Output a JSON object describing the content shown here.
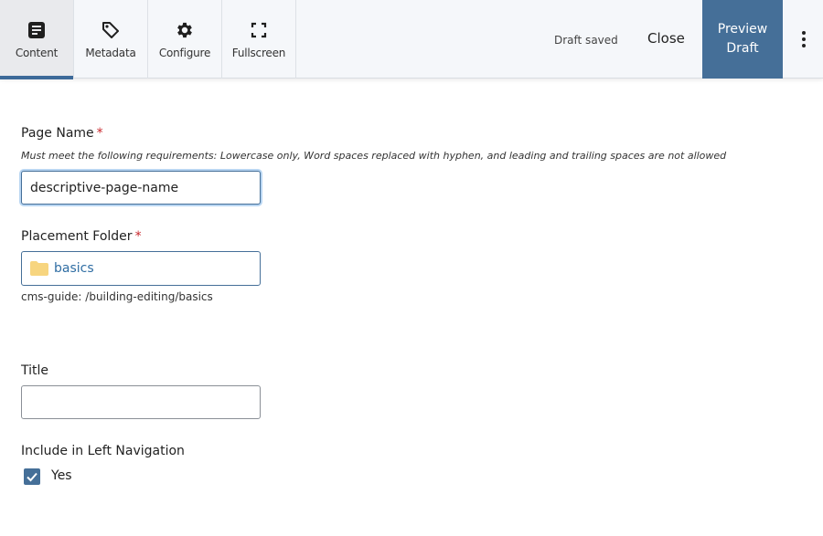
{
  "toolbar": {
    "tabs": [
      {
        "label": "Content",
        "icon": "document-icon",
        "active": true
      },
      {
        "label": "Metadata",
        "icon": "tag-icon",
        "active": false
      },
      {
        "label": "Configure",
        "icon": "gear-icon",
        "active": false
      },
      {
        "label": "Fullscreen",
        "icon": "fullscreen-icon",
        "active": false
      }
    ],
    "status": "Draft saved",
    "close_label": "Close",
    "preview_label_line1": "Preview",
    "preview_label_line2": "Draft",
    "more_icon": "kebab-menu-icon"
  },
  "form": {
    "page_name": {
      "label": "Page Name",
      "required_mark": "*",
      "hint": "Must meet the following requirements: Lowercase only, Word spaces replaced with hyphen, and leading and trailing spaces are not allowed",
      "value": "descriptive-page-name"
    },
    "placement_folder": {
      "label": "Placement Folder",
      "required_mark": "*",
      "folder_icon": "folder-icon",
      "value": "basics",
      "path": "cms-guide: /building-editing/basics"
    },
    "title": {
      "label": "Title",
      "value": ""
    },
    "left_nav": {
      "label": "Include in Left Navigation",
      "option_label": "Yes",
      "checked": true
    }
  },
  "colors": {
    "accent": "#456f98",
    "required": "#c8262b",
    "folder": "#f7d57f",
    "link": "#2f6da3"
  }
}
